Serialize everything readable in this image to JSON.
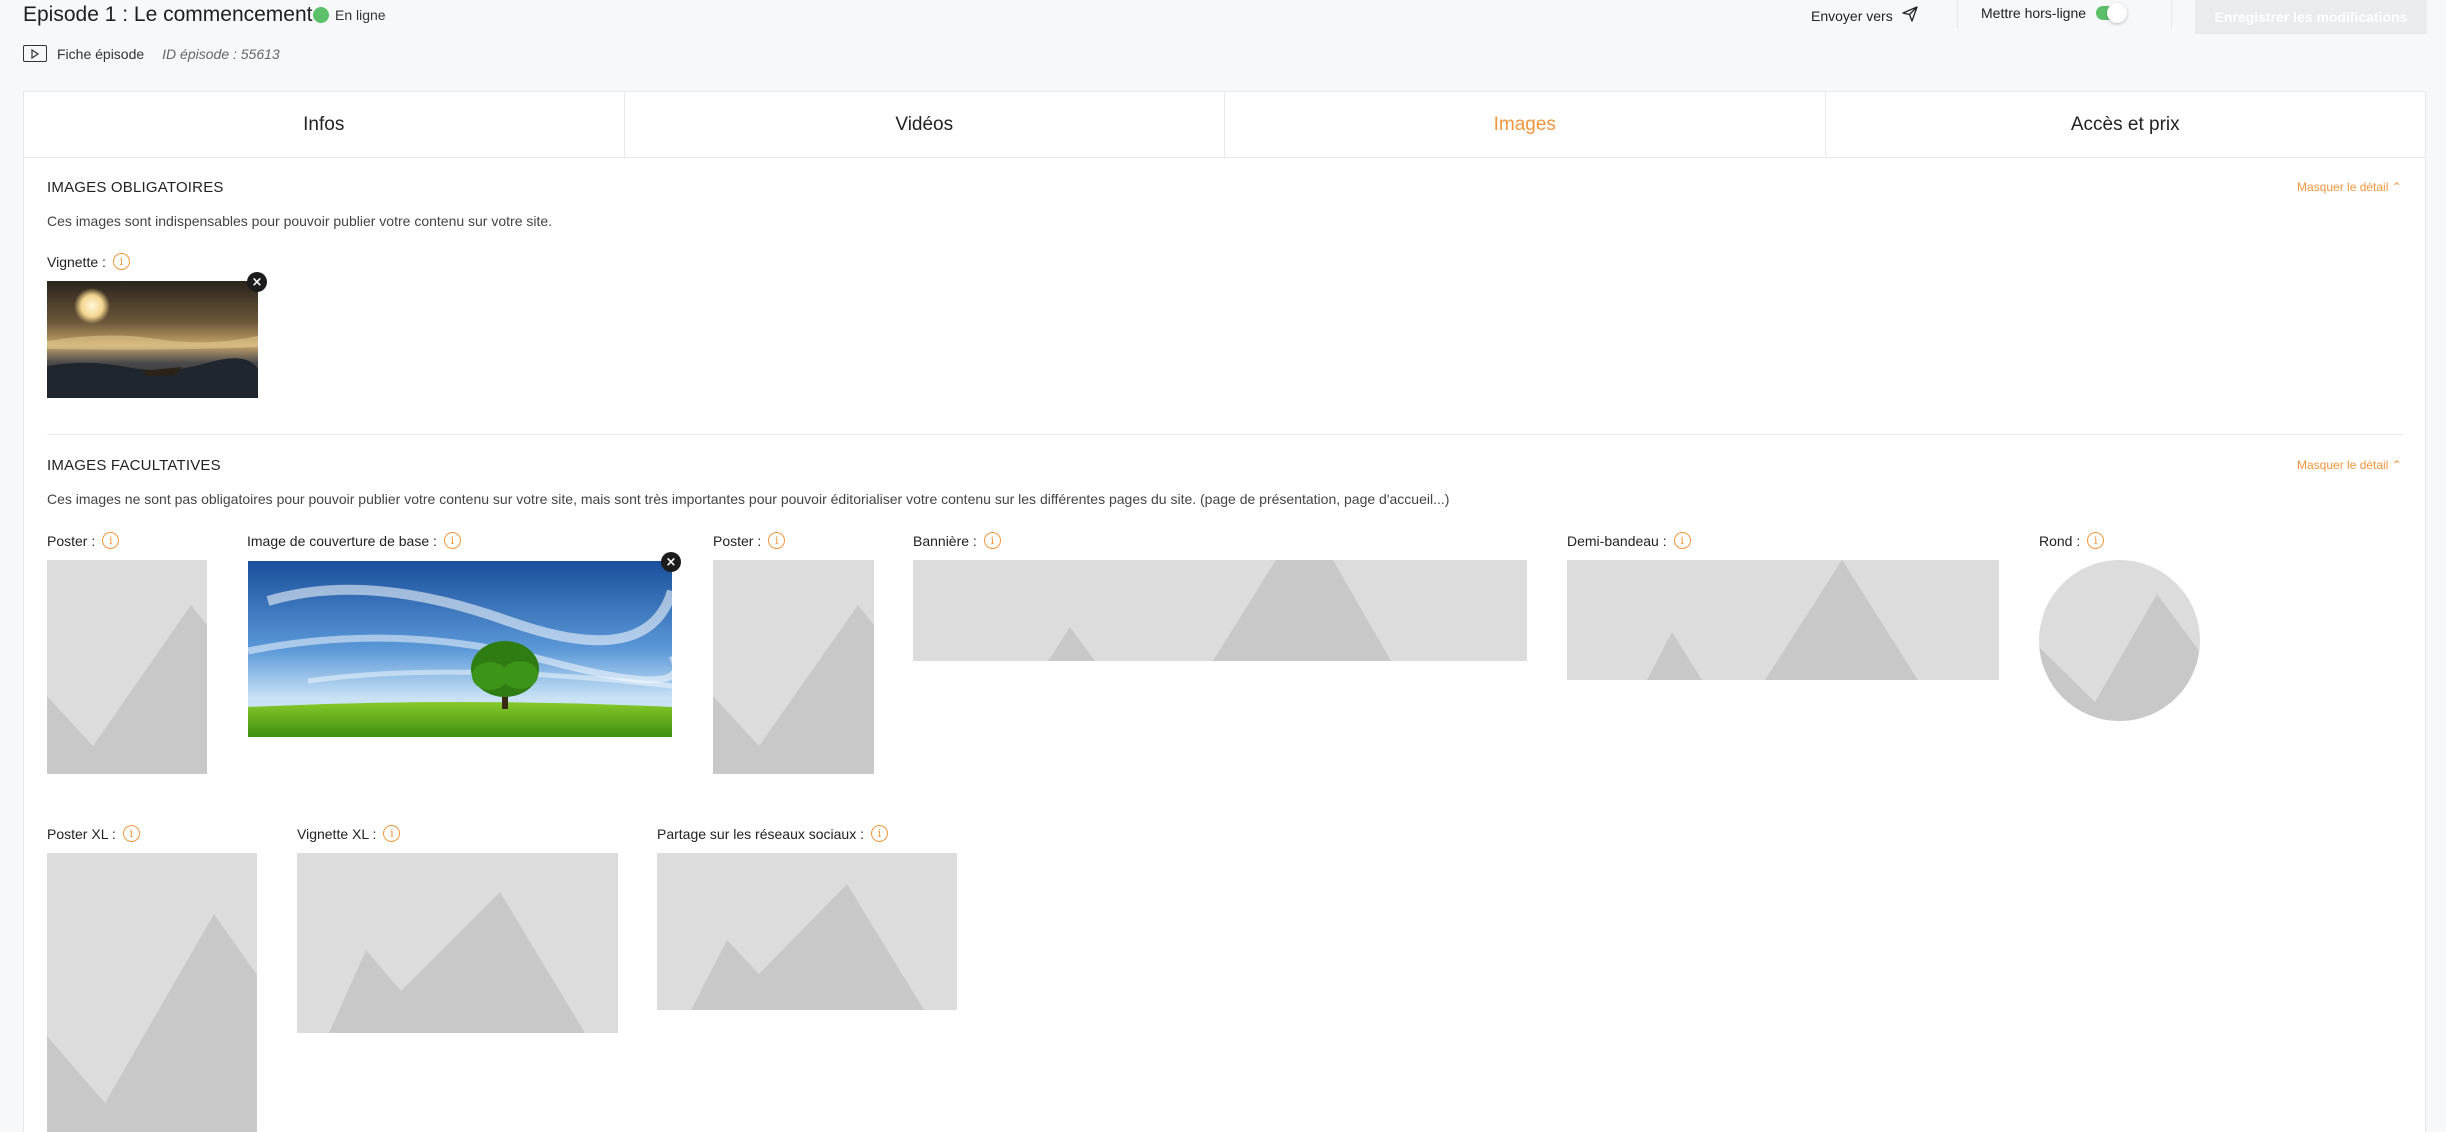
{
  "header": {
    "title": "Episode 1 : Le commencement",
    "status": "En ligne",
    "breadcrumb_label": "Fiche épisode",
    "episode_id": "ID épisode : 55613",
    "send_to": "Envoyer vers",
    "offline_label": "Mettre hors-ligne",
    "save_label": "Enregistrer les modifications",
    "colors": {
      "status": "#5cbf6a",
      "accent": "#f0963e"
    }
  },
  "tabs": [
    {
      "label": "Infos",
      "active": false
    },
    {
      "label": "Vidéos",
      "active": false
    },
    {
      "label": "Images",
      "active": true
    },
    {
      "label": "Accès et prix",
      "active": false
    }
  ],
  "mandatory": {
    "title": "IMAGES OBLIGATOIRES",
    "description": "Ces images sont indispensables pour pouvoir publier votre contenu sur votre site.",
    "toggle": "Masquer le détail ⌃",
    "fields": [
      {
        "label": "Vignette :",
        "filled": true
      }
    ]
  },
  "optional": {
    "title": "IMAGES FACULTATIVES",
    "description": "Ces images ne sont pas obligatoires pour pouvoir publier votre contenu sur votre site, mais sont très importantes pour pouvoir éditorialiser votre contenu sur les différentes pages du site. (page de présentation, page d'accueil...)",
    "toggle": "Masquer le détail ⌃",
    "fields": [
      {
        "label": "Poster :",
        "filled": false
      },
      {
        "label": "Image de couverture de base :",
        "filled": true
      },
      {
        "label": "Poster :",
        "filled": false
      },
      {
        "label": "Bannière :",
        "filled": false
      },
      {
        "label": "Demi-bandeau :",
        "filled": false
      },
      {
        "label": "Rond :",
        "filled": false
      },
      {
        "label": "Poster XL :",
        "filled": false
      },
      {
        "label": "Vignette XL :",
        "filled": false
      },
      {
        "label": "Partage sur les réseaux sociaux :",
        "filled": false
      }
    ]
  },
  "icons": {
    "info": "info-icon",
    "remove": "close-icon",
    "send": "paper-plane-icon",
    "video": "video-icon"
  }
}
